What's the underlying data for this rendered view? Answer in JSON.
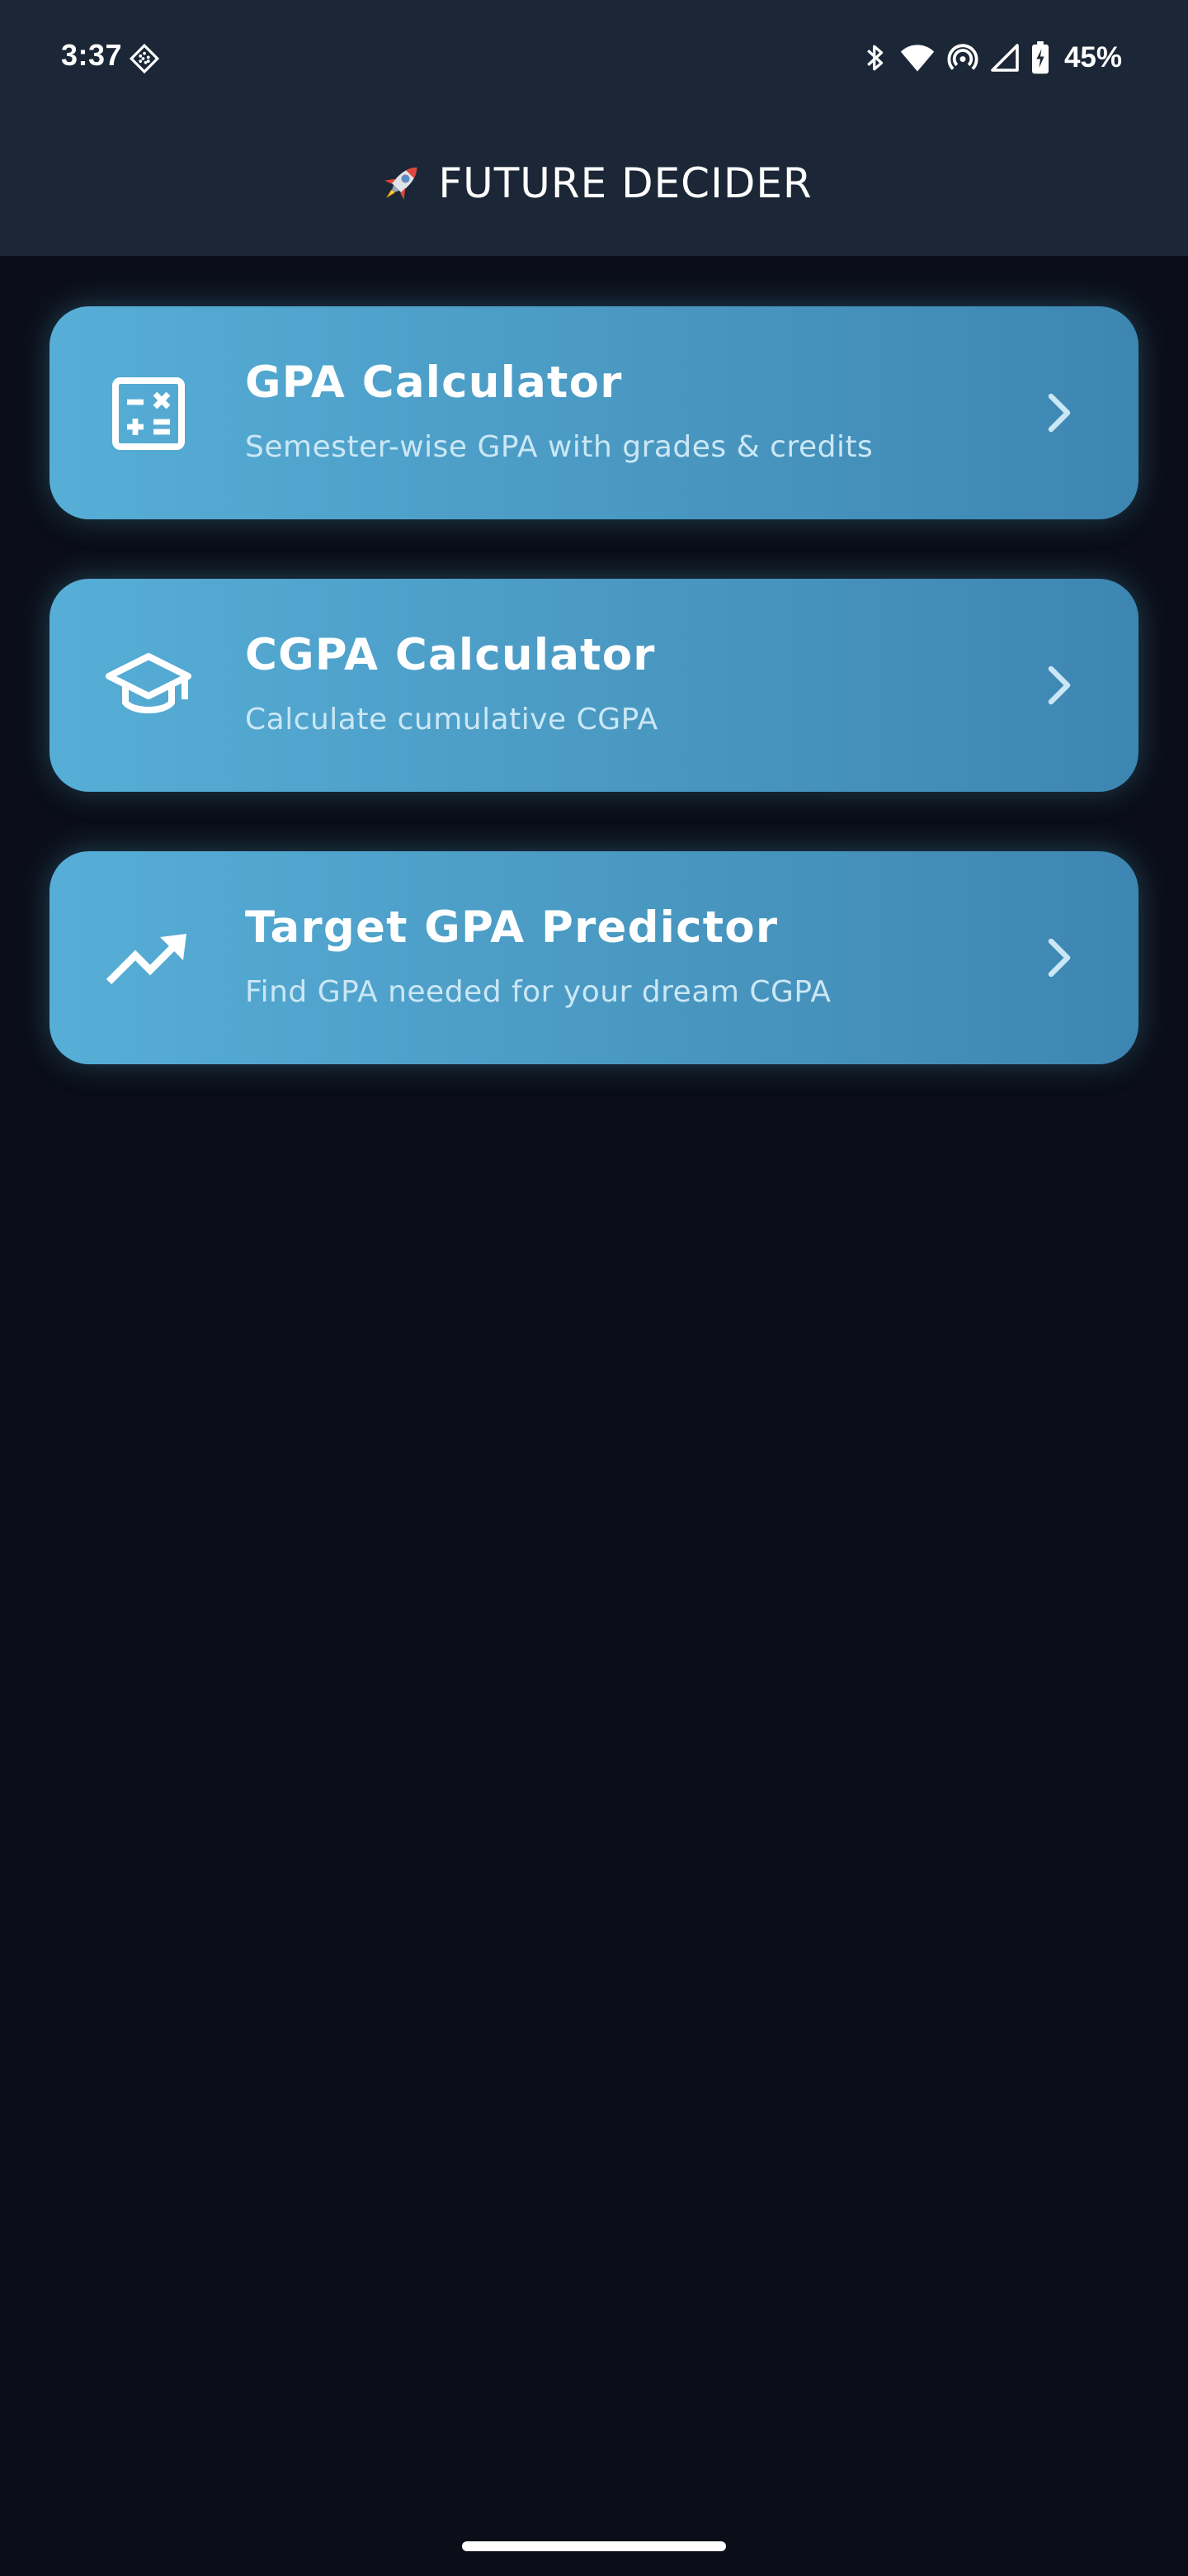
{
  "status_bar": {
    "time": "3:37",
    "battery": "45%",
    "icons": [
      "notification-diamond-icon",
      "bluetooth-icon",
      "wifi-icon",
      "hotspot-icon",
      "cellular-signal-icon",
      "battery-charging-icon"
    ]
  },
  "app_bar": {
    "icon": "rocket-icon",
    "title": "FUTURE DECIDER"
  },
  "cards": [
    {
      "icon": "calculator-icon",
      "title": "GPA Calculator",
      "subtitle": "Semester-wise GPA with grades & credits"
    },
    {
      "icon": "graduation-cap-icon",
      "title": "CGPA Calculator",
      "subtitle": "Calculate cumulative CGPA"
    },
    {
      "icon": "trending-up-icon",
      "title": "Target GPA Predictor",
      "subtitle": "Find GPA needed for your dream CGPA"
    }
  ],
  "colors": {
    "background": "#0b0e18",
    "top_bar": "#1b2736",
    "card_gradient_start": "#56aed6",
    "card_gradient_end": "#3d86b2",
    "card_subtitle": "#cbe7f5"
  }
}
